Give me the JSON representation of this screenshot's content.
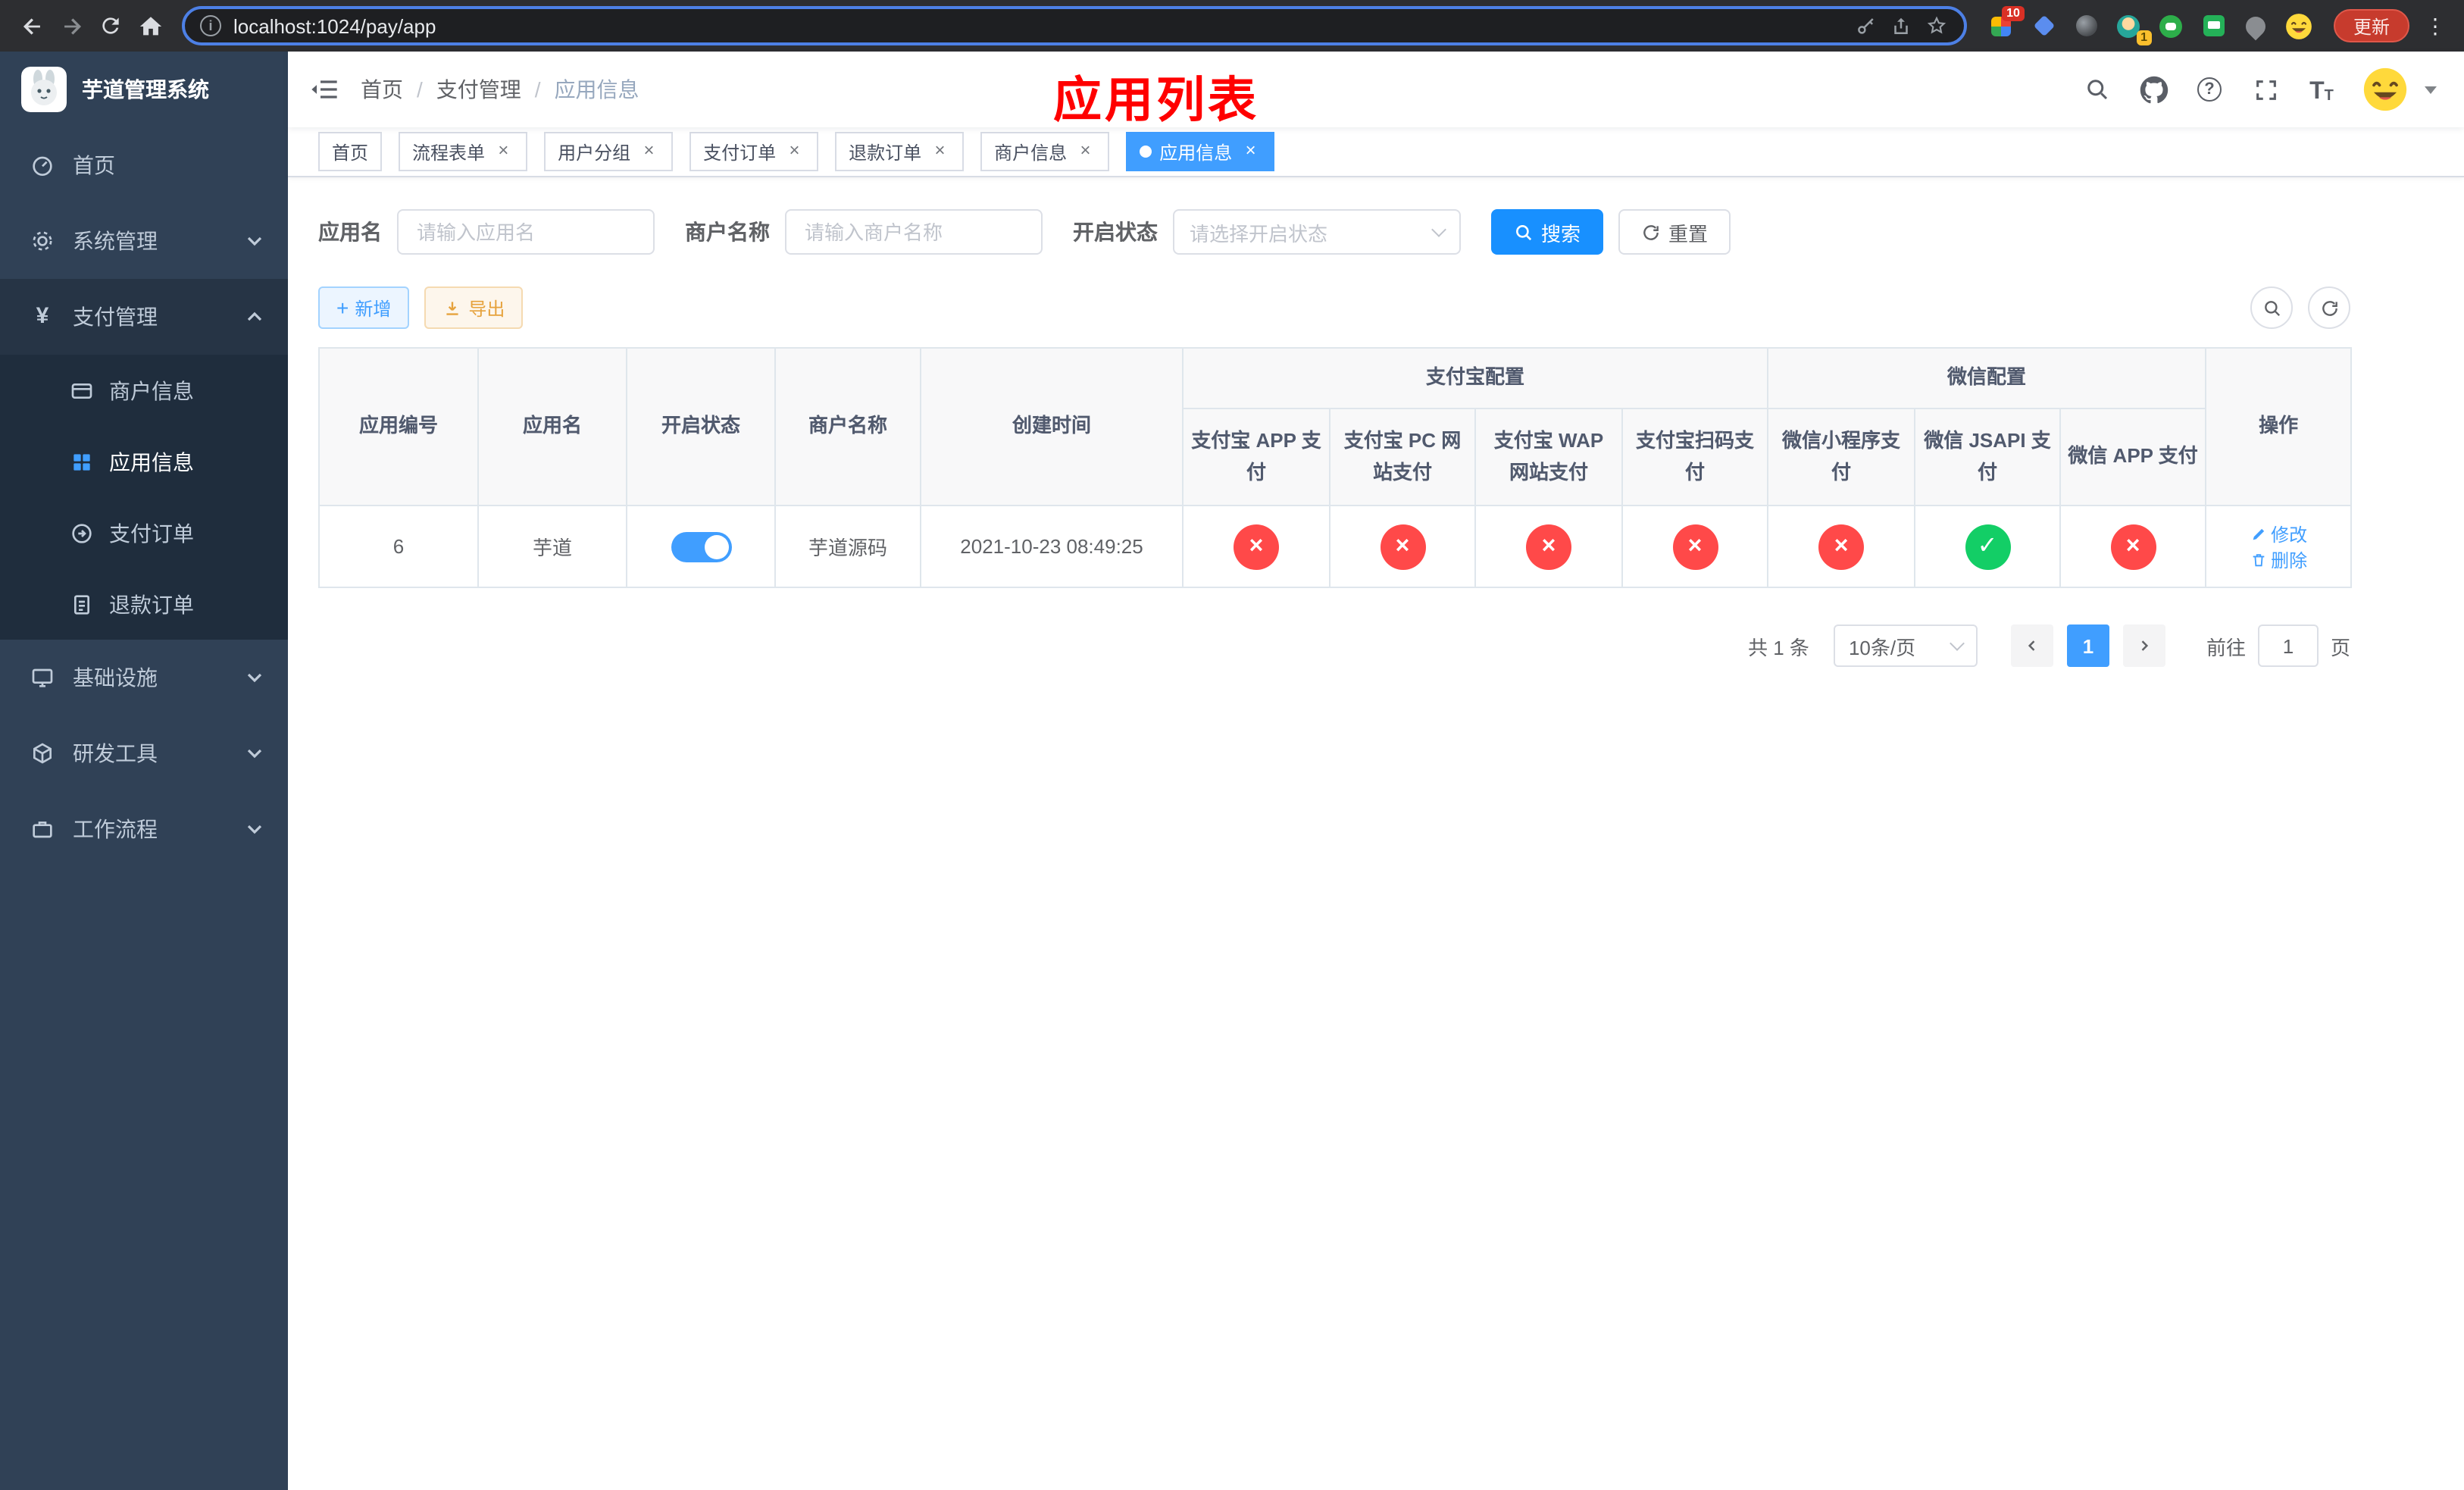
{
  "browser": {
    "url": "localhost:1024/pay/app",
    "update_button": "更新",
    "ext_badge_10": "10",
    "ext_badge_1": "1"
  },
  "sidebar": {
    "title": "芋道管理系统",
    "items": [
      {
        "label": "首页"
      },
      {
        "label": "系统管理"
      },
      {
        "label": "支付管理"
      },
      {
        "label": "商户信息"
      },
      {
        "label": "应用信息"
      },
      {
        "label": "支付订单"
      },
      {
        "label": "退款订单"
      },
      {
        "label": "基础设施"
      },
      {
        "label": "研发工具"
      },
      {
        "label": "工作流程"
      }
    ]
  },
  "header": {
    "breadcrumb": [
      "首页",
      "支付管理",
      "应用信息"
    ],
    "overlay_title": "应用列表"
  },
  "tabs": [
    {
      "label": "首页"
    },
    {
      "label": "流程表单"
    },
    {
      "label": "用户分组"
    },
    {
      "label": "支付订单"
    },
    {
      "label": "退款订单"
    },
    {
      "label": "商户信息"
    },
    {
      "label": "应用信息"
    }
  ],
  "filters": {
    "app_name_label": "应用名",
    "app_name_placeholder": "请输入应用名",
    "merchant_label": "商户名称",
    "merchant_placeholder": "请输入商户名称",
    "status_label": "开启状态",
    "status_placeholder": "请选择开启状态",
    "search_button": "搜索",
    "reset_button": "重置"
  },
  "toolbar": {
    "add_button": "新增",
    "export_button": "导出"
  },
  "table": {
    "headers": {
      "app_id": "应用编号",
      "app_name": "应用名",
      "status": "开启状态",
      "merchant": "商户名称",
      "created": "创建时间",
      "alipay_group": "支付宝配置",
      "wechat_group": "微信配置",
      "alipay_app": "支付宝 APP 支付",
      "alipay_pc": "支付宝 PC 网站支付",
      "alipay_wap": "支付宝 WAP 网站支付",
      "alipay_qr": "支付宝扫码支付",
      "wx_mini": "微信小程序支付",
      "wx_jsapi": "微信 JSAPI 支付",
      "wx_app": "微信 APP 支付",
      "actions": "操作"
    },
    "row": {
      "id": "6",
      "name": "芋道",
      "merchant": "芋道源码",
      "created_at": "2021-10-23 08:49:25",
      "edit_link": "修改",
      "delete_link": "删除"
    }
  },
  "icons": {
    "cross": "×",
    "check": "✓",
    "plus": "+",
    "close": "×",
    "kebab": "⋮"
  },
  "pagination": {
    "total": "共 1 条",
    "page_size": "10条/页",
    "page": "1",
    "goto_label": "前往",
    "goto_value": "1",
    "unit_label": "页"
  }
}
